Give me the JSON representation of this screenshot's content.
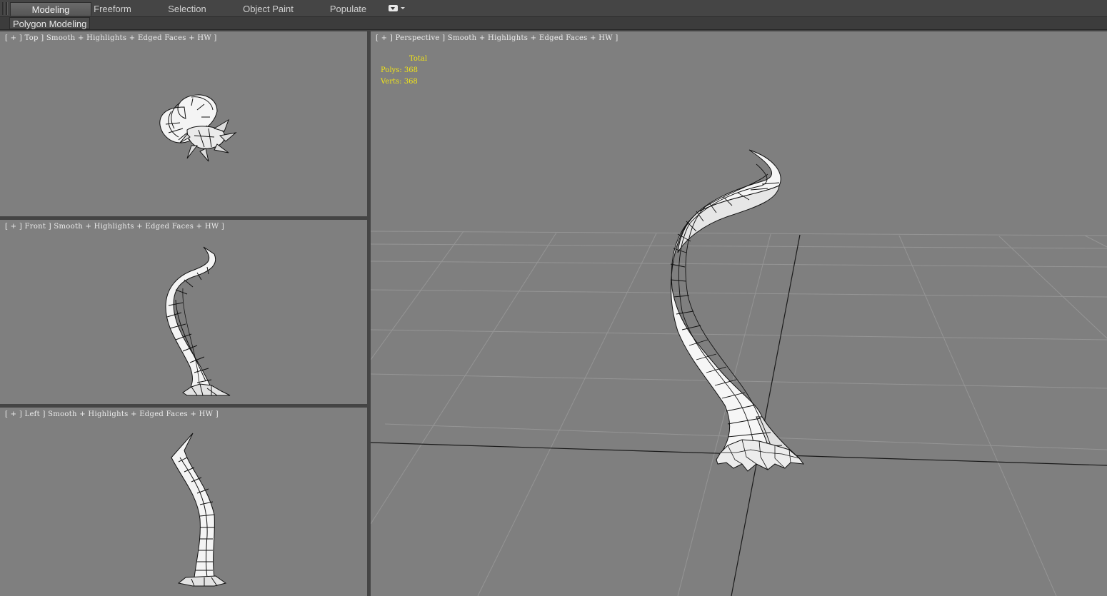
{
  "ribbon": {
    "tabs": [
      {
        "label": "Modeling",
        "active": true
      },
      {
        "label": "Freeform",
        "active": false
      },
      {
        "label": "Selection",
        "active": false
      },
      {
        "label": "Object Paint",
        "active": false
      },
      {
        "label": "Populate",
        "active": false
      }
    ],
    "panel_label": "Polygon Modeling"
  },
  "viewports": {
    "top": {
      "label": "[ + ] Top ] Smooth + Highlights + Edged Faces + HW ]"
    },
    "front": {
      "label": "[ + ] Front ] Smooth + Highlights + Edged Faces + HW ]"
    },
    "left": {
      "label": "[ + ] Left ] Smooth + Highlights + Edged Faces + HW ]"
    },
    "perspective": {
      "label": "[ + ] Perspective ] Smooth + Highlights + Edged Faces + HW ]"
    }
  },
  "stats": {
    "header": "Total",
    "polys": "Polys: 368",
    "verts": "Verts: 368"
  },
  "colors": {
    "viewport_bg": "#7f7f7f",
    "stats_text": "#f0e318",
    "ui_bg": "#444444"
  }
}
